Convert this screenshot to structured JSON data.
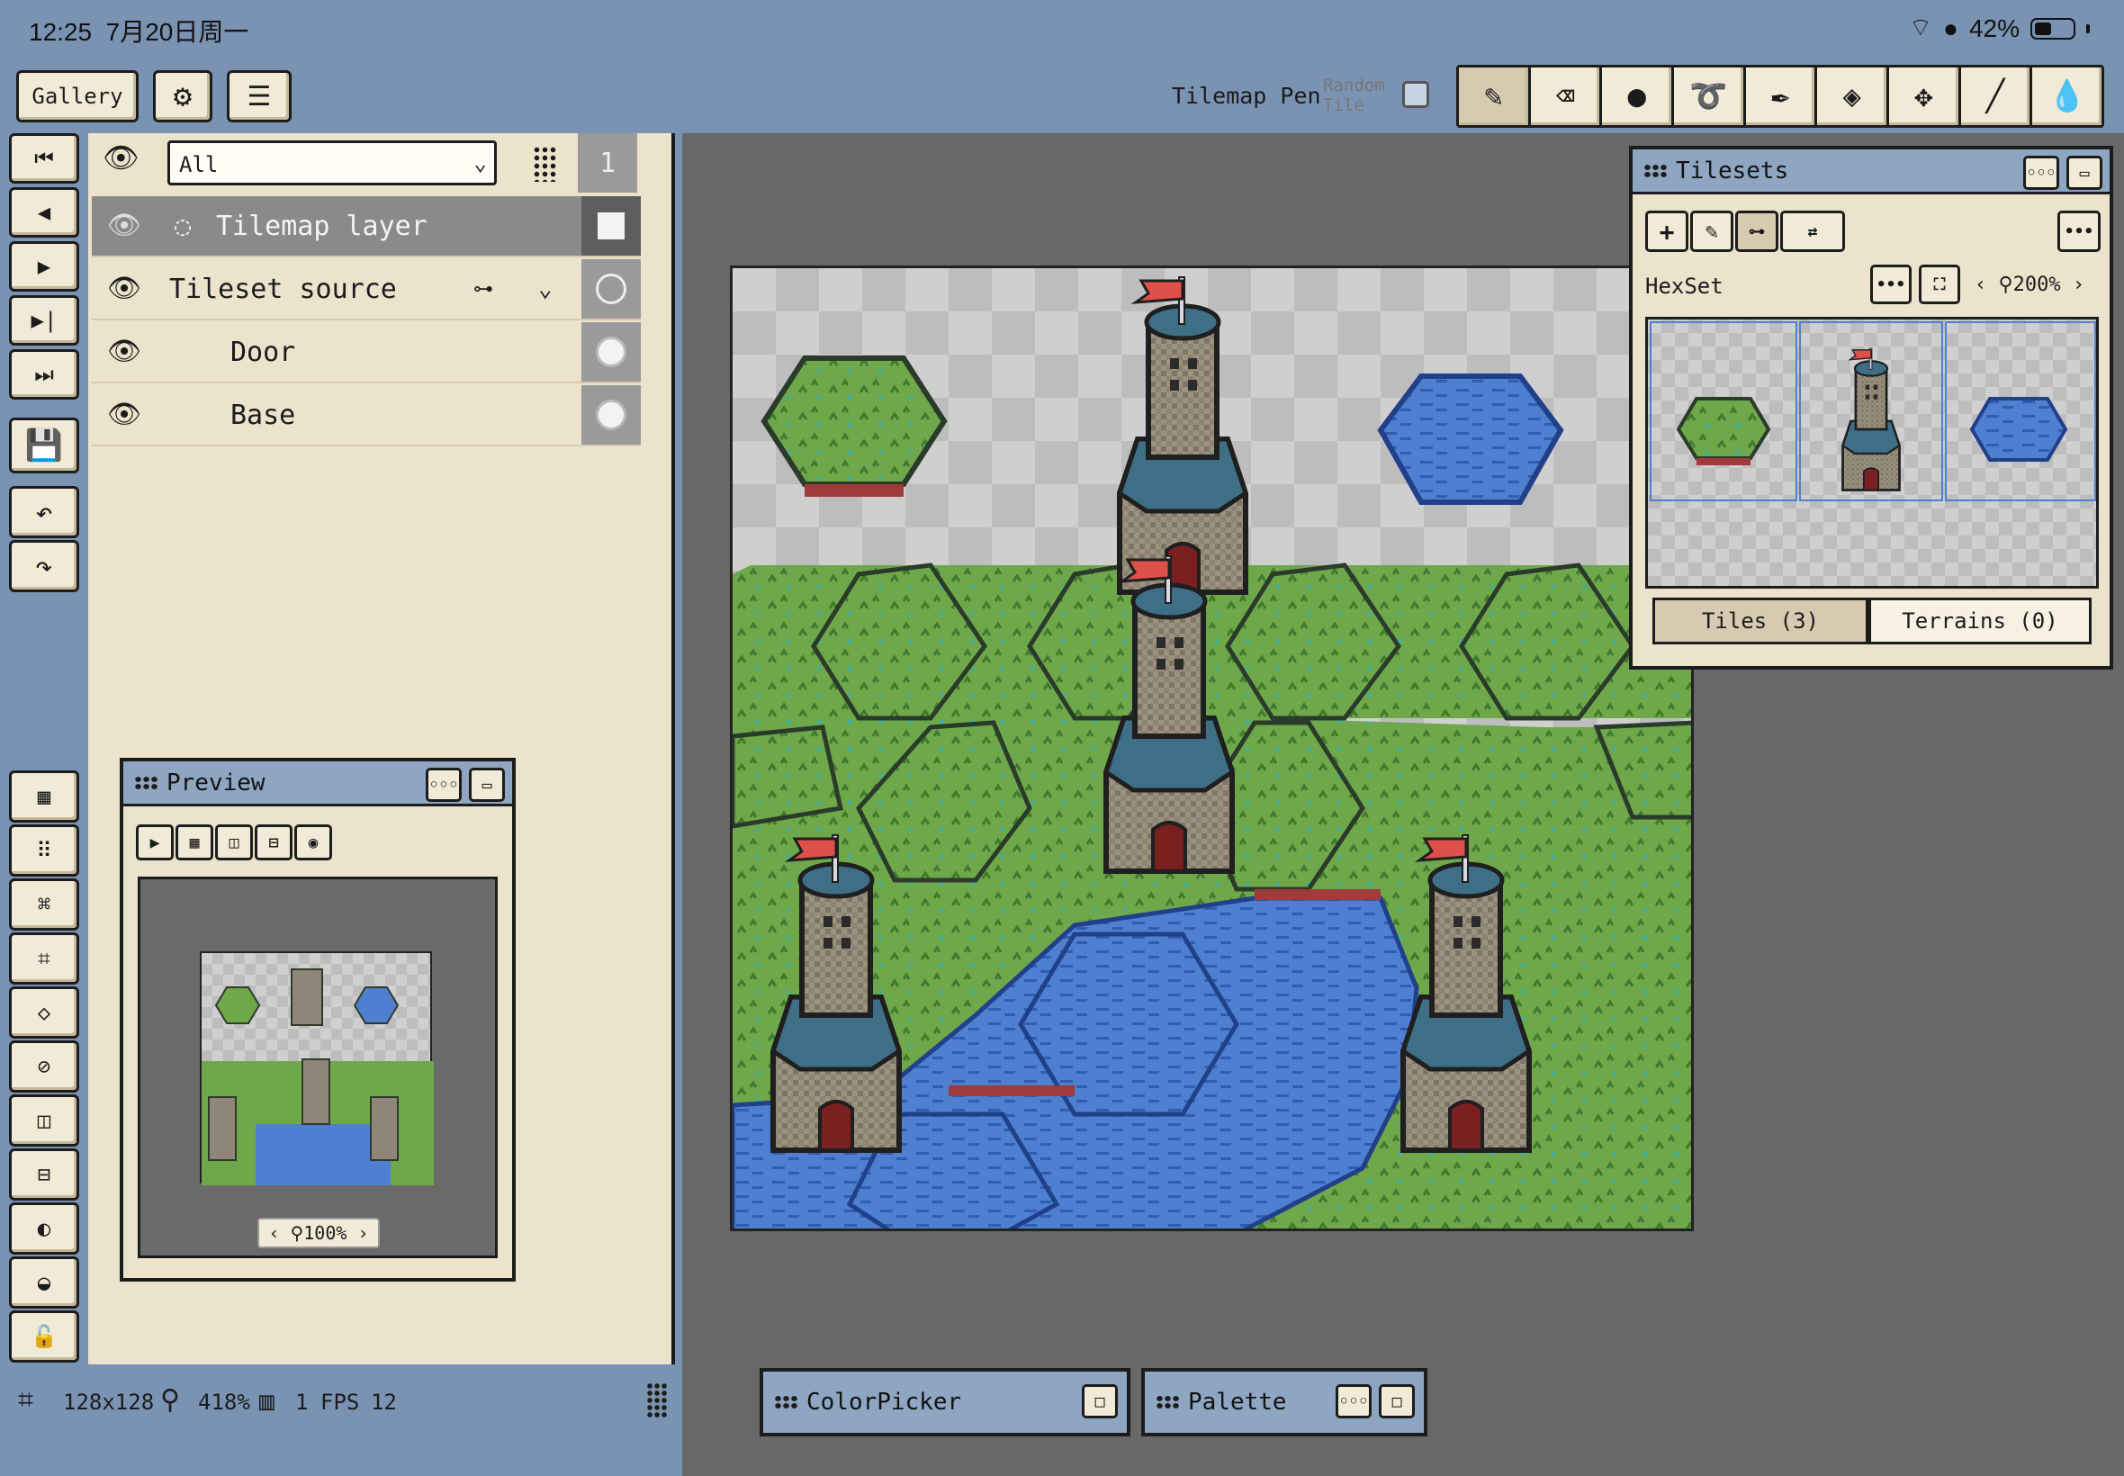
{
  "status": {
    "time": "12:25",
    "date": "7月20日周一",
    "battery": "42%"
  },
  "toolbar": {
    "gallery_label": "Gallery",
    "tool_name": "Tilemap Pen",
    "random_tile_label": "Random Tile",
    "tools": [
      "pencil-icon",
      "eraser-icon",
      "blur-icon",
      "lasso-icon",
      "eyedropper-icon",
      "fill-bucket-icon",
      "move-icon",
      "line-icon",
      "smudge-icon"
    ]
  },
  "layers": {
    "filter_value": "All",
    "frame_number": "1",
    "rows": [
      {
        "name": "Tilemap layer",
        "selected": true
      },
      {
        "name": "Tileset source",
        "selected": false
      },
      {
        "name": "Door",
        "selected": false
      },
      {
        "name": "Base",
        "selected": false
      }
    ]
  },
  "preview": {
    "title": "Preview",
    "zoom": "100%"
  },
  "tilesets": {
    "title": "Tilesets",
    "tileset_name": "HexSet",
    "zoom": "200%",
    "tab_tiles": "Tiles (3)",
    "tab_terrains": "Terrains (0)"
  },
  "bottom_panels": {
    "colorpicker_title": "ColorPicker",
    "palette_title": "Palette"
  },
  "footer": {
    "canvas_size": "128x128",
    "zoom": "418%",
    "frames": "1",
    "fps_label": "FPS",
    "fps_value": "12"
  },
  "colors": {
    "grass": "#6fa84a",
    "water": "#4f7fd0",
    "stone": "#8e8676",
    "roof": "#3e6f86",
    "flag": "#e0504a"
  }
}
